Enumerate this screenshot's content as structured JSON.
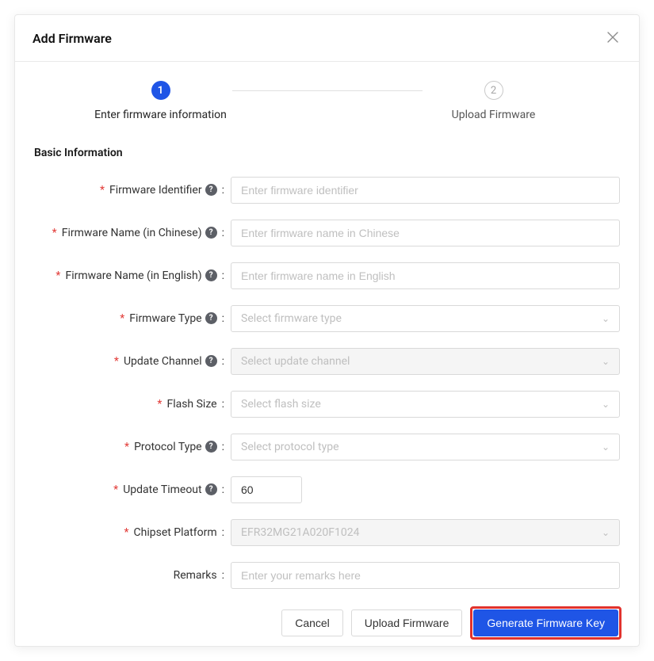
{
  "modal": {
    "title": "Add Firmware"
  },
  "stepper": {
    "step1": {
      "num": "1",
      "label": "Enter firmware information"
    },
    "step2": {
      "num": "2",
      "label": "Upload Firmware"
    }
  },
  "section": {
    "basic": "Basic Information"
  },
  "labels": {
    "firmware_identifier": "Firmware Identifier",
    "firmware_name_cn": "Firmware Name (in Chinese)",
    "firmware_name_en": "Firmware Name (in English)",
    "firmware_type": "Firmware Type",
    "update_channel": "Update Channel",
    "flash_size": "Flash Size",
    "protocol_type": "Protocol Type",
    "update_timeout": "Update Timeout",
    "chipset_platform": "Chipset Platform",
    "remarks": "Remarks"
  },
  "placeholders": {
    "firmware_identifier": "Enter firmware identifier",
    "firmware_name_cn": "Enter firmware name in Chinese",
    "firmware_name_en": "Enter firmware name in English",
    "firmware_type": "Select firmware type",
    "update_channel": "Select update channel",
    "flash_size": "Select flash size",
    "protocol_type": "Select protocol type",
    "remarks": "Enter your remarks here"
  },
  "values": {
    "update_timeout": "60",
    "chipset_platform": "EFR32MG21A020F1024"
  },
  "footer": {
    "cancel": "Cancel",
    "upload": "Upload Firmware",
    "generate": "Generate Firmware Key"
  }
}
